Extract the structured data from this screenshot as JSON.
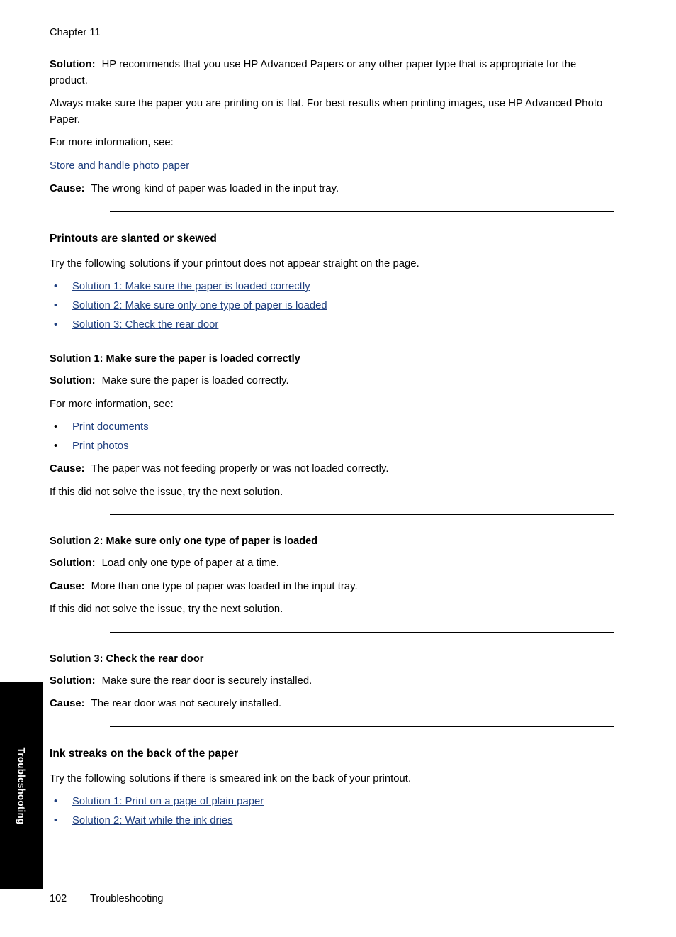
{
  "page": {
    "chapter_header": "Chapter 11",
    "footer_page_number": "102",
    "footer_title": "Troubleshooting",
    "thumb_tab_label": "Troubleshooting",
    "link_color": "#1f3f7f",
    "text_color": "#000000",
    "background_color": "#ffffff",
    "tab_color": "#000000"
  },
  "labels": {
    "solution": "Solution:",
    "cause": "Cause:",
    "for_more_information": "For more information, see:",
    "next_solution": "If this did not solve the issue, try the next solution.",
    "bullet_glyph": "•"
  },
  "intro_block": {
    "solution_text": "HP recommends that you use HP Advanced Papers or any other paper type that is appropriate for the product.",
    "paragraph_2": "Always make sure the paper you are printing on is flat. For best results when printing images, use HP Advanced Photo Paper.",
    "see_also_intro": "For more information, see:",
    "link": "Store and handle photo paper",
    "cause_text": "The wrong kind of paper was loaded in the input tray."
  },
  "section_skewed": {
    "heading": "Printouts are slanted or skewed",
    "intro": "Try the following solutions if your printout does not appear straight on the page.",
    "links": [
      "Solution 1: Make sure the paper is loaded correctly",
      "Solution 2: Make sure only one type of paper is loaded",
      "Solution 3: Check the rear door"
    ],
    "solutions": [
      {
        "heading": "Solution 1: Make sure the paper is loaded correctly",
        "solution_text": "Make sure the paper is loaded correctly.",
        "see_also_intro": "For more information, see:",
        "links": [
          "Print documents",
          "Print photos"
        ],
        "cause_text": "The paper was not feeding properly or was not loaded correctly.",
        "next_solution": "If this did not solve the issue, try the next solution."
      },
      {
        "heading": "Solution 2: Make sure only one type of paper is loaded",
        "solution_text": "Load only one type of paper at a time.",
        "cause_text": "More than one type of paper was loaded in the input tray.",
        "next_solution": "If this did not solve the issue, try the next solution."
      },
      {
        "heading": "Solution 3: Check the rear door",
        "solution_text": "Make sure the rear door is securely installed.",
        "cause_text": "The rear door was not securely installed."
      }
    ]
  },
  "section_ink_streaks": {
    "heading": "Ink streaks on the back of the paper",
    "intro": "Try the following solutions if there is smeared ink on the back of your printout.",
    "links": [
      "Solution 1: Print on a page of plain paper",
      "Solution 2: Wait while the ink dries"
    ]
  }
}
